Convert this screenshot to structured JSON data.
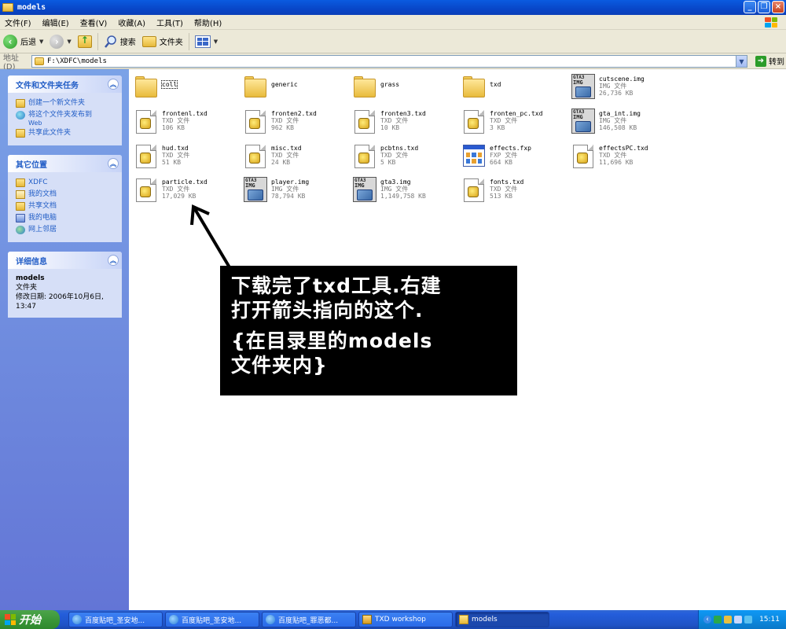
{
  "window": {
    "title": "models",
    "minimize_label": "_",
    "maximize_label": "❐",
    "close_label": "×"
  },
  "menu": [
    "文件(F)",
    "编辑(E)",
    "查看(V)",
    "收藏(A)",
    "工具(T)",
    "帮助(H)"
  ],
  "toolbar": {
    "back_label": "后退",
    "search_label": "搜索",
    "folders_label": "文件夹"
  },
  "address": {
    "label": "地址(D)",
    "value": "F:\\XDFC\\models",
    "go_label": "转到"
  },
  "tasks_panel": {
    "title": "文件和文件夹任务",
    "items": [
      "创建一个新文件夹",
      "将这个文件夹发布到",
      "共享此文件夹"
    ],
    "publish_sub": "Web"
  },
  "places_panel": {
    "title": "其它位置",
    "items": [
      "XDFC",
      "我的文档",
      "共享文档",
      "我的电脑",
      "网上邻居"
    ]
  },
  "details_panel": {
    "title": "详细信息",
    "name": "models",
    "type": "文件夹",
    "modified": "修改日期: 2006年10月6日, 13:47"
  },
  "files": [
    {
      "name": "coll",
      "kind": "folder",
      "type": "",
      "size": ""
    },
    {
      "name": "generic",
      "kind": "folder",
      "type": "",
      "size": ""
    },
    {
      "name": "grass",
      "kind": "folder",
      "type": "",
      "size": ""
    },
    {
      "name": "txd",
      "kind": "folder",
      "type": "",
      "size": ""
    },
    {
      "name": "cutscene.img",
      "kind": "img",
      "type": "IMG 文件",
      "size": "26,736 KB"
    },
    {
      "name": "frontenl.txd",
      "kind": "txd",
      "type": "TXD 文件",
      "size": "106 KB"
    },
    {
      "name": "fronten2.txd",
      "kind": "txd",
      "type": "TXD 文件",
      "size": "962 KB"
    },
    {
      "name": "fronten3.txd",
      "kind": "txd",
      "type": "TXD 文件",
      "size": "10 KB"
    },
    {
      "name": "fronten_pc.txd",
      "kind": "txd",
      "type": "TXD 文件",
      "size": "3 KB"
    },
    {
      "name": "gta_int.img",
      "kind": "img",
      "type": "IMG 文件",
      "size": "146,508 KB"
    },
    {
      "name": "hud.txd",
      "kind": "txd",
      "type": "TXD 文件",
      "size": "51 KB"
    },
    {
      "name": "misc.txd",
      "kind": "txd",
      "type": "TXD 文件",
      "size": "24 KB"
    },
    {
      "name": "pcbtns.txd",
      "kind": "txd",
      "type": "TXD 文件",
      "size": "5 KB"
    },
    {
      "name": "effects.fxp",
      "kind": "fxp",
      "type": "FXP 文件",
      "size": "664 KB"
    },
    {
      "name": "effectsPC.txd",
      "kind": "txd",
      "type": "TXD 文件",
      "size": "11,696 KB"
    },
    {
      "name": "particle.txd",
      "kind": "txd",
      "type": "TXD 文件",
      "size": "17,029 KB"
    },
    {
      "name": "player.img",
      "kind": "img",
      "type": "IMG 文件",
      "size": "78,794 KB"
    },
    {
      "name": "gta3.img",
      "kind": "img",
      "type": "IMG 文件",
      "size": "1,149,758 KB"
    },
    {
      "name": "fonts.txd",
      "kind": "txd",
      "type": "TXD 文件",
      "size": "513 KB"
    }
  ],
  "annotation": {
    "line1": "下载完了txd工具.右建",
    "line2": "打开箭头指向的这个.",
    "line3": "{在目录里的models",
    "line4": "文件夹内}"
  },
  "taskbar": {
    "start_label": "开始",
    "buttons": [
      {
        "label": "百度贴吧_圣安地...",
        "icon": "ie-icon",
        "active": false
      },
      {
        "label": "百度贴吧_圣安地...",
        "icon": "ie-icon",
        "active": false
      },
      {
        "label": "百度贴吧_罪恶都...",
        "icon": "ie-icon",
        "active": false
      },
      {
        "label": "TXD workshop",
        "icon": "app-icon",
        "active": false
      },
      {
        "label": "models",
        "icon": "folder-icon",
        "active": true
      }
    ],
    "clock": "15:11"
  },
  "colors": {
    "title_bar": "#0846c8",
    "left_pane": "#6f8ede",
    "panel_title": "#215dc6",
    "start_button": "#3b9739",
    "annotation_bg": "#000000"
  },
  "icons": [
    "folder-icon",
    "txd-file-icon",
    "img-file-icon",
    "fxp-file-icon",
    "back-icon",
    "forward-icon",
    "up-icon",
    "search-icon",
    "folders-icon",
    "views-icon",
    "go-icon"
  ]
}
